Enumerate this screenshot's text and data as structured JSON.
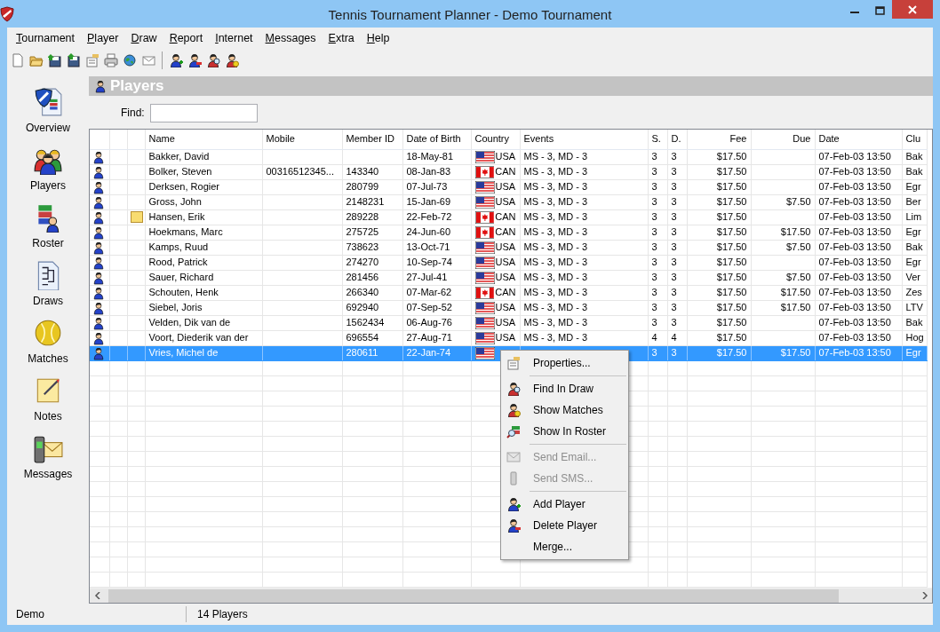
{
  "window": {
    "title": "Tennis Tournament Planner - Demo Tournament"
  },
  "menu_bar": [
    "Tournament",
    "Player",
    "Draw",
    "Report",
    "Internet",
    "Messages",
    "Extra",
    "Help"
  ],
  "sidebar": {
    "items": [
      {
        "label": "Overview"
      },
      {
        "label": "Players"
      },
      {
        "label": "Roster"
      },
      {
        "label": "Draws"
      },
      {
        "label": "Matches"
      },
      {
        "label": "Notes"
      },
      {
        "label": "Messages"
      }
    ]
  },
  "panel": {
    "title": "Players",
    "find_label": "Find:"
  },
  "table": {
    "columns": [
      "Name",
      "Mobile",
      "Member ID",
      "Date of Birth",
      "Country",
      "Events",
      "S.",
      "D.",
      "Fee",
      "Due",
      "Date",
      "Clu"
    ],
    "rows": [
      {
        "note": false,
        "selected": false,
        "name": "Bakker, David",
        "date_of_birth": "18-May-81",
        "kind": "us",
        "country": "USA",
        "events": "MS - 3, MD - 3",
        "s": "3",
        "d": "3",
        "fee": "$17.50",
        "date": "07-Feb-03 13:50",
        "club": "Bak"
      },
      {
        "note": false,
        "selected": false,
        "name": "Bolker, Steven",
        "mobile": "00316512345...",
        "member_id": "143340",
        "date_of_birth": "08-Jan-83",
        "kind": "ca",
        "country": "CAN",
        "events": "MS - 3, MD - 3",
        "s": "3",
        "d": "3",
        "fee": "$17.50",
        "date": "07-Feb-03 13:50",
        "club": "Bak"
      },
      {
        "note": false,
        "selected": false,
        "name": "Derksen, Rogier",
        "member_id": "280799",
        "date_of_birth": "07-Jul-73",
        "kind": "us",
        "country": "USA",
        "events": "MS - 3, MD - 3",
        "s": "3",
        "d": "3",
        "fee": "$17.50",
        "date": "07-Feb-03 13:50",
        "club": "Egr"
      },
      {
        "note": false,
        "selected": false,
        "name": "Gross, John",
        "member_id": "2148231",
        "date_of_birth": "15-Jan-69",
        "kind": "us",
        "country": "USA",
        "events": "MS - 3, MD - 3",
        "s": "3",
        "d": "3",
        "fee": "$17.50",
        "due": "$7.50",
        "date": "07-Feb-03 13:50",
        "club": "Ber"
      },
      {
        "note": true,
        "selected": false,
        "name": "Hansen, Erik",
        "member_id": "289228",
        "date_of_birth": "22-Feb-72",
        "kind": "ca",
        "country": "CAN",
        "events": "MS - 3, MD - 3",
        "s": "3",
        "d": "3",
        "fee": "$17.50",
        "date": "07-Feb-03 13:50",
        "club": "Lim"
      },
      {
        "note": false,
        "selected": false,
        "name": "Hoekmans, Marc",
        "member_id": "275725",
        "date_of_birth": "24-Jun-60",
        "kind": "ca",
        "country": "CAN",
        "events": "MS - 3, MD - 3",
        "s": "3",
        "d": "3",
        "fee": "$17.50",
        "due": "$17.50",
        "date": "07-Feb-03 13:50",
        "club": "Egr"
      },
      {
        "note": false,
        "selected": false,
        "name": "Kamps, Ruud",
        "member_id": "738623",
        "date_of_birth": "13-Oct-71",
        "kind": "us",
        "country": "USA",
        "events": "MS - 3, MD - 3",
        "s": "3",
        "d": "3",
        "fee": "$17.50",
        "due": "$7.50",
        "date": "07-Feb-03 13:50",
        "club": "Bak"
      },
      {
        "note": false,
        "selected": false,
        "name": "Rood, Patrick",
        "member_id": "274270",
        "date_of_birth": "10-Sep-74",
        "kind": "us",
        "country": "USA",
        "events": "MS - 3, MD - 3",
        "s": "3",
        "d": "3",
        "fee": "$17.50",
        "date": "07-Feb-03 13:50",
        "club": "Egr"
      },
      {
        "note": false,
        "selected": false,
        "name": "Sauer, Richard",
        "member_id": "281456",
        "date_of_birth": "27-Jul-41",
        "kind": "us",
        "country": "USA",
        "events": "MS - 3, MD - 3",
        "s": "3",
        "d": "3",
        "fee": "$17.50",
        "due": "$7.50",
        "date": "07-Feb-03 13:50",
        "club": "Ver"
      },
      {
        "note": false,
        "selected": false,
        "name": "Schouten, Henk",
        "member_id": "266340",
        "date_of_birth": "07-Mar-62",
        "kind": "ca",
        "country": "CAN",
        "events": "MS - 3, MD - 3",
        "s": "3",
        "d": "3",
        "fee": "$17.50",
        "due": "$17.50",
        "date": "07-Feb-03 13:50",
        "club": "Zes"
      },
      {
        "note": false,
        "selected": false,
        "name": "Siebel, Joris",
        "member_id": "692940",
        "date_of_birth": "07-Sep-52",
        "kind": "us",
        "country": "USA",
        "events": "MS - 3, MD - 3",
        "s": "3",
        "d": "3",
        "fee": "$17.50",
        "due": "$17.50",
        "date": "07-Feb-03 13:50",
        "club": "LTV"
      },
      {
        "note": false,
        "selected": false,
        "name": "Velden, Dik van de",
        "member_id": "1562434",
        "date_of_birth": "06-Aug-76",
        "kind": "us",
        "country": "USA",
        "events": "MS - 3, MD - 3",
        "s": "3",
        "d": "3",
        "fee": "$17.50",
        "date": "07-Feb-03 13:50",
        "club": "Bak"
      },
      {
        "note": false,
        "selected": false,
        "name": "Voort, Diederik van der",
        "member_id": "696554",
        "date_of_birth": "27-Aug-71",
        "kind": "us",
        "country": "USA",
        "events": "MS - 3, MD - 3",
        "s": "4",
        "d": "4",
        "fee": "$17.50",
        "date": "07-Feb-03 13:50",
        "club": "Hog"
      },
      {
        "note": false,
        "selected": true,
        "name": "Vries, Michel de",
        "member_id": "280611",
        "date_of_birth": "22-Jan-74",
        "kind": "us",
        "s": "3",
        "d": "3",
        "fee": "$17.50",
        "due": "$17.50",
        "date": "07-Feb-03 13:50",
        "club": "Egr"
      }
    ]
  },
  "context_menu": [
    {
      "kind": "item",
      "label": "Properties...",
      "disabled": false
    },
    {
      "kind": "separator"
    },
    {
      "kind": "item",
      "label": "Find In Draw",
      "disabled": false
    },
    {
      "kind": "item",
      "label": "Show Matches",
      "disabled": false
    },
    {
      "kind": "item",
      "label": "Show In Roster",
      "disabled": false
    },
    {
      "kind": "separator"
    },
    {
      "kind": "item",
      "label": "Send Email...",
      "disabled": true
    },
    {
      "kind": "item",
      "label": "Send SMS...",
      "disabled": true
    },
    {
      "kind": "separator"
    },
    {
      "kind": "item",
      "label": "Add Player",
      "disabled": false
    },
    {
      "kind": "item",
      "label": "Delete Player",
      "disabled": false
    },
    {
      "kind": "item",
      "label": "Merge...",
      "disabled": false
    }
  ],
  "status_bar": [
    "Demo",
    "14 Players"
  ]
}
